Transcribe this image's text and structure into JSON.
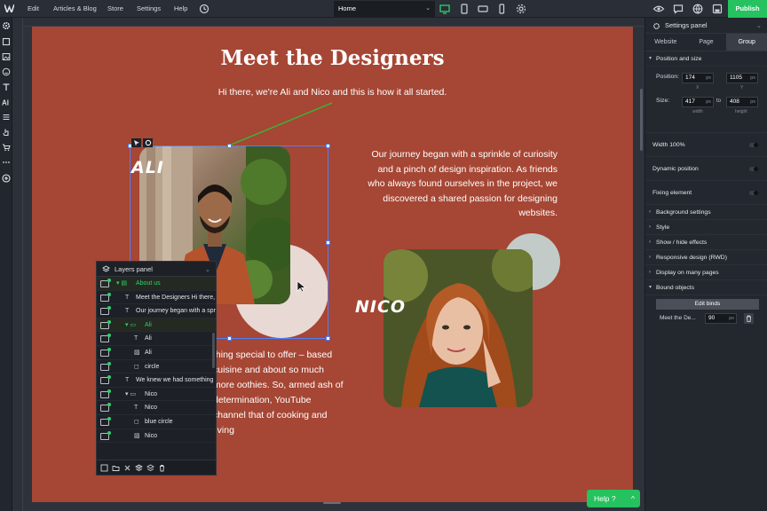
{
  "topbar": {
    "menu": [
      "Edit",
      "Articles & Blog",
      "Store",
      "Settings",
      "Help"
    ],
    "page_select": "Home",
    "publish_label": "Publish"
  },
  "canvas": {
    "title": "Meet the Designers",
    "subtitle": "Hi there, we're Ali and Nico and this is how it all started.",
    "paragraph1": "Our journey began with a sprinkle of curiosity and a pinch of design inspiration. As friends who always found ourselves in the project, we discovered a shared passion for designing websites.",
    "paragraph2": "thing special to offer – based cuisine and about so much more oothies. So, armed ash of determination, YouTube channel that of cooking and living",
    "name_ali": "ALI",
    "name_nico": "NICO",
    "colors": {
      "background": "#a64634",
      "circle_pink": "#e8d9d4",
      "circle_blue": "#c2cbc7"
    }
  },
  "layers_panel": {
    "title": "Layers panel",
    "rows": [
      {
        "label": "About us",
        "kind": "folder-section",
        "indent": 0,
        "selected": true
      },
      {
        "label": "Meet the Designers   Hi there, we're",
        "kind": "text",
        "indent": 1
      },
      {
        "label": "Our journey began with a sprinkle",
        "kind": "text",
        "indent": 1
      },
      {
        "label": "Ali",
        "kind": "folder",
        "indent": 1,
        "selected": true
      },
      {
        "label": "Ali",
        "kind": "text",
        "indent": 2
      },
      {
        "label": "Ali",
        "kind": "image",
        "indent": 2
      },
      {
        "label": "circle",
        "kind": "shape",
        "indent": 2
      },
      {
        "label": "We knew we had something",
        "kind": "text",
        "indent": 1
      },
      {
        "label": "Nico",
        "kind": "folder",
        "indent": 1
      },
      {
        "label": "Nico",
        "kind": "text",
        "indent": 2
      },
      {
        "label": "blue circle",
        "kind": "shape",
        "indent": 2
      },
      {
        "label": "Nico",
        "kind": "image",
        "indent": 2
      }
    ]
  },
  "settings_panel": {
    "title": "Settings panel",
    "tabs": [
      "Website",
      "Page",
      "Group"
    ],
    "active_tab": "Group",
    "position_section": "Position and size",
    "position_label": "Position:",
    "pos_x": "174",
    "pos_y": "1105",
    "pos_unit": "px",
    "x_label": "X",
    "y_label": "Y",
    "size_label": "Size:",
    "width": "417",
    "to_label": "to",
    "height": "408",
    "width_label": "width",
    "height_label": "height",
    "toggles": [
      "Width 100%",
      "Dynamic position",
      "Fixing element"
    ],
    "sections": [
      "Background settings",
      "Style",
      "Show / hide effects",
      "Responsive design (RWD)",
      "Display on many pages",
      "Bound objects"
    ],
    "edit_binds": "Edit binds",
    "bound_item": "Meet the De...",
    "bound_value": "90",
    "bound_unit": "px"
  },
  "help": {
    "label": "Help ?"
  }
}
